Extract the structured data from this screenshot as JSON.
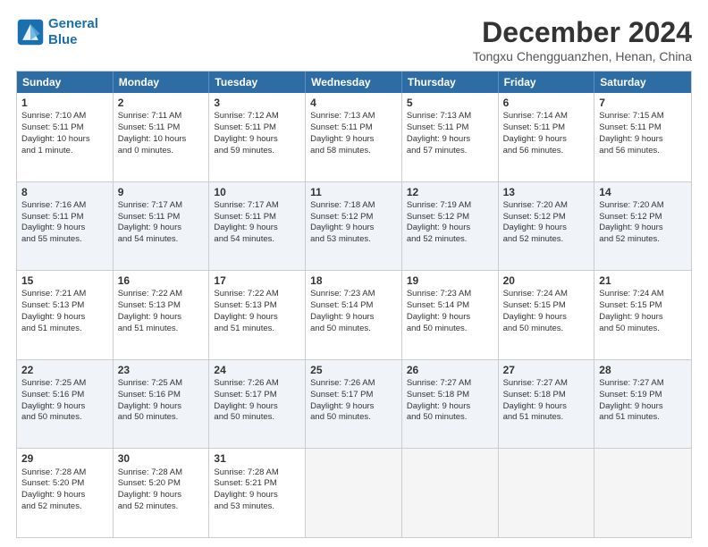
{
  "logo": {
    "line1": "General",
    "line2": "Blue"
  },
  "title": "December 2024",
  "location": "Tongxu Chengguanzhen, Henan, China",
  "header_days": [
    "Sunday",
    "Monday",
    "Tuesday",
    "Wednesday",
    "Thursday",
    "Friday",
    "Saturday"
  ],
  "weeks": [
    [
      {
        "day": "1",
        "lines": [
          "Sunrise: 7:10 AM",
          "Sunset: 5:11 PM",
          "Daylight: 10 hours",
          "and 1 minute."
        ]
      },
      {
        "day": "2",
        "lines": [
          "Sunrise: 7:11 AM",
          "Sunset: 5:11 PM",
          "Daylight: 10 hours",
          "and 0 minutes."
        ]
      },
      {
        "day": "3",
        "lines": [
          "Sunrise: 7:12 AM",
          "Sunset: 5:11 PM",
          "Daylight: 9 hours",
          "and 59 minutes."
        ]
      },
      {
        "day": "4",
        "lines": [
          "Sunrise: 7:13 AM",
          "Sunset: 5:11 PM",
          "Daylight: 9 hours",
          "and 58 minutes."
        ]
      },
      {
        "day": "5",
        "lines": [
          "Sunrise: 7:13 AM",
          "Sunset: 5:11 PM",
          "Daylight: 9 hours",
          "and 57 minutes."
        ]
      },
      {
        "day": "6",
        "lines": [
          "Sunrise: 7:14 AM",
          "Sunset: 5:11 PM",
          "Daylight: 9 hours",
          "and 56 minutes."
        ]
      },
      {
        "day": "7",
        "lines": [
          "Sunrise: 7:15 AM",
          "Sunset: 5:11 PM",
          "Daylight: 9 hours",
          "and 56 minutes."
        ]
      }
    ],
    [
      {
        "day": "8",
        "lines": [
          "Sunrise: 7:16 AM",
          "Sunset: 5:11 PM",
          "Daylight: 9 hours",
          "and 55 minutes."
        ]
      },
      {
        "day": "9",
        "lines": [
          "Sunrise: 7:17 AM",
          "Sunset: 5:11 PM",
          "Daylight: 9 hours",
          "and 54 minutes."
        ]
      },
      {
        "day": "10",
        "lines": [
          "Sunrise: 7:17 AM",
          "Sunset: 5:11 PM",
          "Daylight: 9 hours",
          "and 54 minutes."
        ]
      },
      {
        "day": "11",
        "lines": [
          "Sunrise: 7:18 AM",
          "Sunset: 5:12 PM",
          "Daylight: 9 hours",
          "and 53 minutes."
        ]
      },
      {
        "day": "12",
        "lines": [
          "Sunrise: 7:19 AM",
          "Sunset: 5:12 PM",
          "Daylight: 9 hours",
          "and 52 minutes."
        ]
      },
      {
        "day": "13",
        "lines": [
          "Sunrise: 7:20 AM",
          "Sunset: 5:12 PM",
          "Daylight: 9 hours",
          "and 52 minutes."
        ]
      },
      {
        "day": "14",
        "lines": [
          "Sunrise: 7:20 AM",
          "Sunset: 5:12 PM",
          "Daylight: 9 hours",
          "and 52 minutes."
        ]
      }
    ],
    [
      {
        "day": "15",
        "lines": [
          "Sunrise: 7:21 AM",
          "Sunset: 5:13 PM",
          "Daylight: 9 hours",
          "and 51 minutes."
        ]
      },
      {
        "day": "16",
        "lines": [
          "Sunrise: 7:22 AM",
          "Sunset: 5:13 PM",
          "Daylight: 9 hours",
          "and 51 minutes."
        ]
      },
      {
        "day": "17",
        "lines": [
          "Sunrise: 7:22 AM",
          "Sunset: 5:13 PM",
          "Daylight: 9 hours",
          "and 51 minutes."
        ]
      },
      {
        "day": "18",
        "lines": [
          "Sunrise: 7:23 AM",
          "Sunset: 5:14 PM",
          "Daylight: 9 hours",
          "and 50 minutes."
        ]
      },
      {
        "day": "19",
        "lines": [
          "Sunrise: 7:23 AM",
          "Sunset: 5:14 PM",
          "Daylight: 9 hours",
          "and 50 minutes."
        ]
      },
      {
        "day": "20",
        "lines": [
          "Sunrise: 7:24 AM",
          "Sunset: 5:15 PM",
          "Daylight: 9 hours",
          "and 50 minutes."
        ]
      },
      {
        "day": "21",
        "lines": [
          "Sunrise: 7:24 AM",
          "Sunset: 5:15 PM",
          "Daylight: 9 hours",
          "and 50 minutes."
        ]
      }
    ],
    [
      {
        "day": "22",
        "lines": [
          "Sunrise: 7:25 AM",
          "Sunset: 5:16 PM",
          "Daylight: 9 hours",
          "and 50 minutes."
        ]
      },
      {
        "day": "23",
        "lines": [
          "Sunrise: 7:25 AM",
          "Sunset: 5:16 PM",
          "Daylight: 9 hours",
          "and 50 minutes."
        ]
      },
      {
        "day": "24",
        "lines": [
          "Sunrise: 7:26 AM",
          "Sunset: 5:17 PM",
          "Daylight: 9 hours",
          "and 50 minutes."
        ]
      },
      {
        "day": "25",
        "lines": [
          "Sunrise: 7:26 AM",
          "Sunset: 5:17 PM",
          "Daylight: 9 hours",
          "and 50 minutes."
        ]
      },
      {
        "day": "26",
        "lines": [
          "Sunrise: 7:27 AM",
          "Sunset: 5:18 PM",
          "Daylight: 9 hours",
          "and 50 minutes."
        ]
      },
      {
        "day": "27",
        "lines": [
          "Sunrise: 7:27 AM",
          "Sunset: 5:18 PM",
          "Daylight: 9 hours",
          "and 51 minutes."
        ]
      },
      {
        "day": "28",
        "lines": [
          "Sunrise: 7:27 AM",
          "Sunset: 5:19 PM",
          "Daylight: 9 hours",
          "and 51 minutes."
        ]
      }
    ],
    [
      {
        "day": "29",
        "lines": [
          "Sunrise: 7:28 AM",
          "Sunset: 5:20 PM",
          "Daylight: 9 hours",
          "and 52 minutes."
        ]
      },
      {
        "day": "30",
        "lines": [
          "Sunrise: 7:28 AM",
          "Sunset: 5:20 PM",
          "Daylight: 9 hours",
          "and 52 minutes."
        ]
      },
      {
        "day": "31",
        "lines": [
          "Sunrise: 7:28 AM",
          "Sunset: 5:21 PM",
          "Daylight: 9 hours",
          "and 53 minutes."
        ]
      },
      {
        "day": "",
        "lines": []
      },
      {
        "day": "",
        "lines": []
      },
      {
        "day": "",
        "lines": []
      },
      {
        "day": "",
        "lines": []
      }
    ]
  ]
}
